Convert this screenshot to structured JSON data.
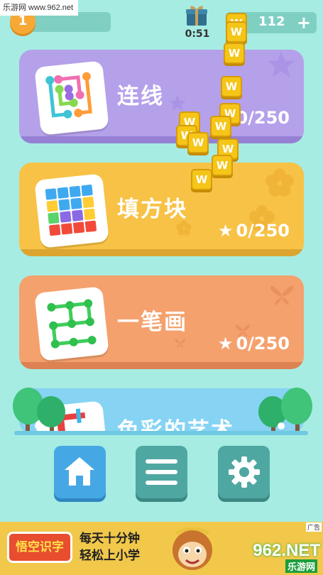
{
  "watermark": "乐游网 www.962.net",
  "header": {
    "level": "1",
    "timer": "0:51",
    "coins": "112",
    "add_symbol": "+"
  },
  "games": [
    {
      "title": "连线",
      "progress": "0/250"
    },
    {
      "title": "填方块",
      "progress": "0/250"
    },
    {
      "title": "一笔画",
      "progress": "0/250"
    },
    {
      "title": "色彩的艺术"
    }
  ],
  "nav": [
    {
      "icon": "home-icon"
    },
    {
      "icon": "menu-icon"
    },
    {
      "icon": "gear-icon"
    }
  ],
  "ad": {
    "logo_text": "悟空识字",
    "slogan_line1": "每天十分钟",
    "slogan_line2": "轻松上小学",
    "brand": "962.NET",
    "brand_sub": "乐游网",
    "ad_indicator": "广告"
  },
  "tile_letter": "W",
  "colors": {
    "background": "#a6ece3",
    "card1": "#b5a0ea",
    "card2": "#f7c245",
    "card3": "#f5a16d",
    "card4": "#86d3f4",
    "home_button": "#45a8e4",
    "nav_button": "#4fa7a1"
  }
}
